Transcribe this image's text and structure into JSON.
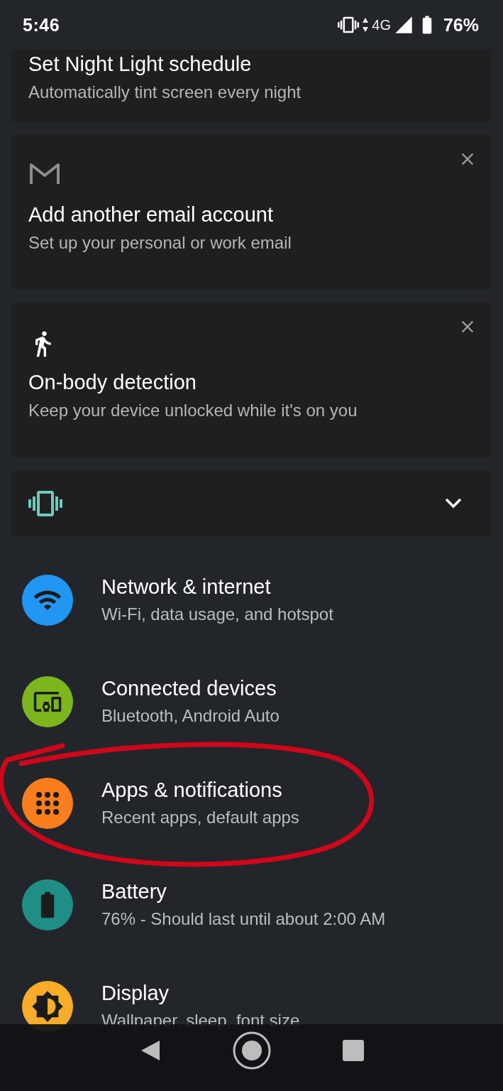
{
  "status_bar": {
    "time": "5:46",
    "network": "4G",
    "battery": "76%"
  },
  "suggestions": [
    {
      "kind": "plain",
      "title": "Set Night Light schedule",
      "subtitle": "Automatically tint screen every night",
      "dismissible": false
    },
    {
      "kind": "mail",
      "title": "Add another email account",
      "subtitle": "Set up your personal or work email",
      "dismissible": true
    },
    {
      "kind": "walk",
      "title": "On-body detection",
      "subtitle": "Keep your device unlocked while it's on you",
      "dismissible": true
    }
  ],
  "condition_card": {
    "kind": "vibrate",
    "expanded": false
  },
  "settings": [
    {
      "kind": "wifi",
      "color": "#2196f3",
      "title": "Network & internet",
      "subtitle": "Wi-Fi, data usage, and hotspot"
    },
    {
      "kind": "devices",
      "color": "#7cb61c",
      "title": "Connected devices",
      "subtitle": "Bluetooth, Android Auto"
    },
    {
      "kind": "apps",
      "color": "#fb7e1e",
      "title": "Apps & notifications",
      "subtitle": "Recent apps, default apps"
    },
    {
      "kind": "battery",
      "color": "#1f8f86",
      "title": "Battery",
      "subtitle": "76% - Should last until about 2:00 AM"
    },
    {
      "kind": "display",
      "color": "#f9ab2a",
      "title": "Display",
      "subtitle": "Wallpaper, sleep, font size"
    }
  ],
  "annotation": {
    "kind": "ellipse"
  }
}
